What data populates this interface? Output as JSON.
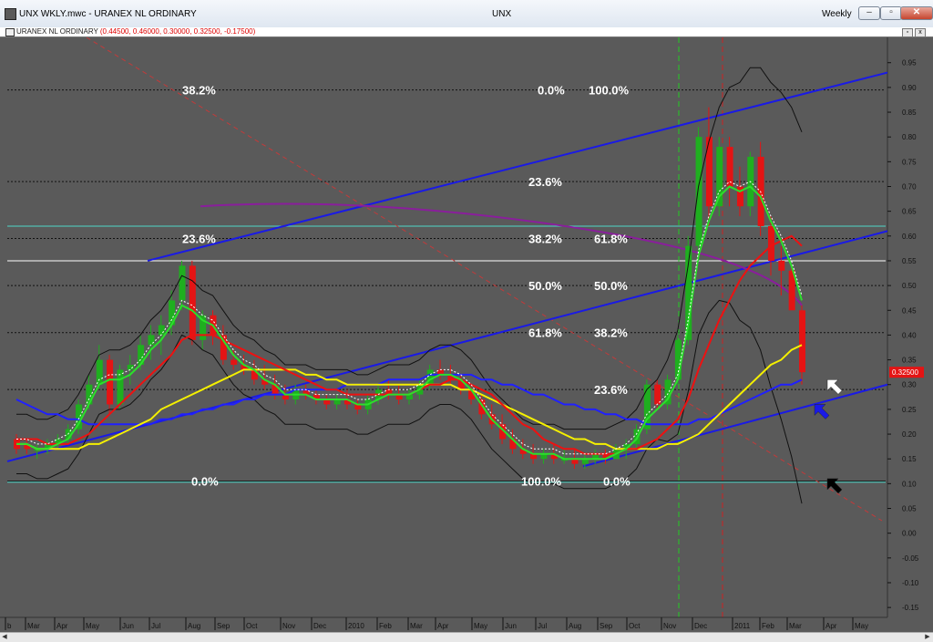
{
  "window": {
    "title": "UNX WKLY.mwc - URANEX NL ORDINARY",
    "center_title": "UNX",
    "period": "Weekly",
    "minimize": "–",
    "restore": "▫",
    "close": "✕"
  },
  "subwindow": {
    "name": "URANEX NL ORDINARY",
    "values": "(0.44500, 0.46000, 0.30000, 0.32500, -0.17500)",
    "restore": "▫",
    "close": "x"
  },
  "colors": {
    "background": "#5a5a5a",
    "up_candle": "#1faf1f",
    "down_candle": "#e41414",
    "ma_green": "#2be02b",
    "ma_red": "#ee1111",
    "ma_yellow": "#f5f000",
    "ma_blue": "#2020ff",
    "ma_purple": "#8a1e9c",
    "trendline": "#1a1ae6"
  },
  "chart_data": {
    "type": "candlestick",
    "title": "UNX",
    "ylim": [
      -0.17,
      0.99
    ],
    "y_ticks": [
      0.95,
      0.9,
      0.85,
      0.8,
      0.75,
      0.7,
      0.65,
      0.6,
      0.55,
      0.5,
      0.45,
      0.4,
      0.35,
      0.3,
      0.25,
      0.2,
      0.15,
      0.1,
      0.05,
      0.0,
      -0.05,
      -0.1,
      -0.15
    ],
    "x_labels": [
      "b",
      "Mar",
      "Apr",
      "May",
      "Jun",
      "Jul",
      "Aug",
      "Sep",
      "Oct",
      "Nov",
      "Dec",
      "2010",
      "Feb",
      "Mar",
      "Apr",
      "May",
      "Jun",
      "Jul",
      "Aug",
      "Sep",
      "Oct",
      "Nov",
      "Dec",
      "2011",
      "Feb",
      "Mar",
      "Apr",
      "May"
    ],
    "last_price_label": "0.32500",
    "candles": [
      [
        0.19,
        0.2,
        0.16,
        0.17
      ],
      [
        0.18,
        0.19,
        0.16,
        0.17
      ],
      [
        0.17,
        0.18,
        0.15,
        0.17
      ],
      [
        0.17,
        0.19,
        0.16,
        0.18
      ],
      [
        0.18,
        0.2,
        0.17,
        0.19
      ],
      [
        0.19,
        0.22,
        0.18,
        0.21
      ],
      [
        0.21,
        0.27,
        0.2,
        0.26
      ],
      [
        0.26,
        0.32,
        0.25,
        0.3
      ],
      [
        0.3,
        0.38,
        0.29,
        0.35
      ],
      [
        0.35,
        0.36,
        0.24,
        0.26
      ],
      [
        0.26,
        0.34,
        0.25,
        0.33
      ],
      [
        0.33,
        0.36,
        0.3,
        0.34
      ],
      [
        0.34,
        0.4,
        0.33,
        0.38
      ],
      [
        0.38,
        0.42,
        0.35,
        0.4
      ],
      [
        0.4,
        0.44,
        0.36,
        0.42
      ],
      [
        0.42,
        0.49,
        0.4,
        0.47
      ],
      [
        0.47,
        0.55,
        0.45,
        0.54
      ],
      [
        0.54,
        0.55,
        0.38,
        0.39
      ],
      [
        0.39,
        0.45,
        0.37,
        0.44
      ],
      [
        0.44,
        0.45,
        0.38,
        0.4
      ],
      [
        0.4,
        0.42,
        0.34,
        0.35
      ],
      [
        0.35,
        0.37,
        0.33,
        0.34
      ],
      [
        0.34,
        0.36,
        0.32,
        0.33
      ],
      [
        0.33,
        0.35,
        0.3,
        0.31
      ],
      [
        0.31,
        0.34,
        0.29,
        0.3
      ],
      [
        0.3,
        0.32,
        0.27,
        0.28
      ],
      [
        0.28,
        0.3,
        0.26,
        0.27
      ],
      [
        0.27,
        0.3,
        0.26,
        0.29
      ],
      [
        0.29,
        0.3,
        0.27,
        0.28
      ],
      [
        0.28,
        0.29,
        0.26,
        0.27
      ],
      [
        0.27,
        0.28,
        0.25,
        0.26
      ],
      [
        0.26,
        0.28,
        0.25,
        0.27
      ],
      [
        0.27,
        0.29,
        0.25,
        0.26
      ],
      [
        0.26,
        0.27,
        0.24,
        0.25
      ],
      [
        0.25,
        0.28,
        0.24,
        0.27
      ],
      [
        0.27,
        0.3,
        0.26,
        0.29
      ],
      [
        0.29,
        0.31,
        0.27,
        0.28
      ],
      [
        0.28,
        0.3,
        0.26,
        0.27
      ],
      [
        0.27,
        0.29,
        0.26,
        0.28
      ],
      [
        0.28,
        0.31,
        0.27,
        0.3
      ],
      [
        0.3,
        0.34,
        0.29,
        0.33
      ],
      [
        0.33,
        0.35,
        0.31,
        0.32
      ],
      [
        0.32,
        0.34,
        0.3,
        0.31
      ],
      [
        0.31,
        0.32,
        0.28,
        0.29
      ],
      [
        0.29,
        0.3,
        0.26,
        0.27
      ],
      [
        0.27,
        0.28,
        0.23,
        0.24
      ],
      [
        0.24,
        0.26,
        0.21,
        0.22
      ],
      [
        0.22,
        0.24,
        0.18,
        0.19
      ],
      [
        0.19,
        0.21,
        0.16,
        0.17
      ],
      [
        0.17,
        0.19,
        0.15,
        0.16
      ],
      [
        0.16,
        0.18,
        0.14,
        0.15
      ],
      [
        0.15,
        0.17,
        0.14,
        0.16
      ],
      [
        0.16,
        0.18,
        0.14,
        0.15
      ],
      [
        0.15,
        0.17,
        0.14,
        0.15
      ],
      [
        0.15,
        0.17,
        0.13,
        0.14
      ],
      [
        0.14,
        0.16,
        0.13,
        0.15
      ],
      [
        0.15,
        0.17,
        0.14,
        0.16
      ],
      [
        0.16,
        0.17,
        0.14,
        0.15
      ],
      [
        0.15,
        0.18,
        0.15,
        0.17
      ],
      [
        0.17,
        0.19,
        0.15,
        0.18
      ],
      [
        0.18,
        0.22,
        0.17,
        0.21
      ],
      [
        0.21,
        0.31,
        0.2,
        0.3
      ],
      [
        0.3,
        0.31,
        0.25,
        0.26
      ],
      [
        0.26,
        0.32,
        0.25,
        0.31
      ],
      [
        0.31,
        0.4,
        0.3,
        0.39
      ],
      [
        0.39,
        0.6,
        0.38,
        0.58
      ],
      [
        0.58,
        0.82,
        0.55,
        0.8
      ],
      [
        0.8,
        0.86,
        0.62,
        0.66
      ],
      [
        0.66,
        0.8,
        0.64,
        0.78
      ],
      [
        0.78,
        0.8,
        0.66,
        0.7
      ],
      [
        0.7,
        0.74,
        0.64,
        0.66
      ],
      [
        0.66,
        0.77,
        0.64,
        0.76
      ],
      [
        0.76,
        0.79,
        0.6,
        0.62
      ],
      [
        0.62,
        0.64,
        0.52,
        0.55
      ],
      [
        0.55,
        0.58,
        0.48,
        0.53
      ],
      [
        0.53,
        0.54,
        0.46,
        0.45
      ],
      [
        0.45,
        0.46,
        0.3,
        0.325
      ]
    ],
    "moving_averages": {
      "green": [
        0.18,
        0.18,
        0.17,
        0.17,
        0.18,
        0.19,
        0.22,
        0.26,
        0.3,
        0.31,
        0.31,
        0.32,
        0.34,
        0.37,
        0.39,
        0.42,
        0.46,
        0.45,
        0.43,
        0.42,
        0.39,
        0.36,
        0.34,
        0.33,
        0.31,
        0.3,
        0.28,
        0.28,
        0.28,
        0.27,
        0.27,
        0.27,
        0.27,
        0.26,
        0.26,
        0.27,
        0.28,
        0.28,
        0.28,
        0.29,
        0.31,
        0.32,
        0.32,
        0.31,
        0.29,
        0.26,
        0.23,
        0.21,
        0.19,
        0.17,
        0.16,
        0.16,
        0.16,
        0.15,
        0.15,
        0.15,
        0.15,
        0.15,
        0.16,
        0.17,
        0.19,
        0.23,
        0.25,
        0.27,
        0.31,
        0.42,
        0.56,
        0.63,
        0.68,
        0.7,
        0.69,
        0.7,
        0.68,
        0.63,
        0.59,
        0.54,
        0.47
      ],
      "red": [
        0.19,
        0.19,
        0.19,
        0.18,
        0.18,
        0.18,
        0.19,
        0.2,
        0.22,
        0.24,
        0.26,
        0.28,
        0.3,
        0.32,
        0.34,
        0.36,
        0.39,
        0.4,
        0.4,
        0.4,
        0.39,
        0.38,
        0.37,
        0.36,
        0.35,
        0.34,
        0.33,
        0.32,
        0.31,
        0.3,
        0.29,
        0.29,
        0.28,
        0.28,
        0.28,
        0.28,
        0.28,
        0.28,
        0.28,
        0.29,
        0.3,
        0.3,
        0.31,
        0.31,
        0.3,
        0.29,
        0.28,
        0.26,
        0.24,
        0.22,
        0.21,
        0.19,
        0.18,
        0.17,
        0.17,
        0.16,
        0.16,
        0.16,
        0.16,
        0.17,
        0.17,
        0.18,
        0.19,
        0.21,
        0.23,
        0.27,
        0.33,
        0.38,
        0.43,
        0.47,
        0.51,
        0.54,
        0.56,
        0.58,
        0.59,
        0.6,
        0.58
      ],
      "yellow": [
        0.18,
        0.18,
        0.17,
        0.17,
        0.17,
        0.17,
        0.17,
        0.18,
        0.18,
        0.19,
        0.2,
        0.21,
        0.22,
        0.23,
        0.25,
        0.26,
        0.27,
        0.28,
        0.29,
        0.3,
        0.31,
        0.32,
        0.33,
        0.33,
        0.33,
        0.33,
        0.33,
        0.33,
        0.32,
        0.32,
        0.31,
        0.31,
        0.3,
        0.3,
        0.3,
        0.3,
        0.3,
        0.3,
        0.3,
        0.3,
        0.3,
        0.3,
        0.3,
        0.29,
        0.29,
        0.28,
        0.27,
        0.26,
        0.25,
        0.24,
        0.23,
        0.22,
        0.21,
        0.2,
        0.19,
        0.19,
        0.18,
        0.18,
        0.17,
        0.17,
        0.17,
        0.17,
        0.17,
        0.18,
        0.18,
        0.19,
        0.2,
        0.22,
        0.24,
        0.26,
        0.28,
        0.3,
        0.32,
        0.34,
        0.35,
        0.37,
        0.38
      ],
      "blue": [
        0.27,
        0.26,
        0.25,
        0.24,
        0.24,
        0.23,
        0.23,
        0.22,
        0.22,
        0.22,
        0.22,
        0.22,
        0.22,
        0.22,
        0.23,
        0.23,
        0.24,
        0.24,
        0.25,
        0.25,
        0.26,
        0.26,
        0.27,
        0.27,
        0.28,
        0.28,
        0.28,
        0.29,
        0.29,
        0.29,
        0.29,
        0.29,
        0.3,
        0.3,
        0.3,
        0.3,
        0.31,
        0.31,
        0.31,
        0.31,
        0.32,
        0.32,
        0.32,
        0.32,
        0.32,
        0.31,
        0.31,
        0.3,
        0.3,
        0.29,
        0.28,
        0.28,
        0.27,
        0.26,
        0.26,
        0.25,
        0.25,
        0.24,
        0.24,
        0.23,
        0.23,
        0.22,
        0.22,
        0.22,
        0.22,
        0.22,
        0.23,
        0.23,
        0.24,
        0.25,
        0.26,
        0.27,
        0.28,
        0.29,
        0.3,
        0.3,
        0.31
      ]
    },
    "fib_labels_left": [
      "38.2%",
      "23.6%",
      "0.0%"
    ],
    "fib_labels_mid": [
      "0.0%",
      "23.6%",
      "38.2%",
      "50.0%",
      "61.8%",
      "23.6%",
      "100.0%"
    ],
    "fib_labels_right": [
      "100.0%",
      "61.8%",
      "50.0%",
      "38.2%",
      "0.0%"
    ]
  }
}
